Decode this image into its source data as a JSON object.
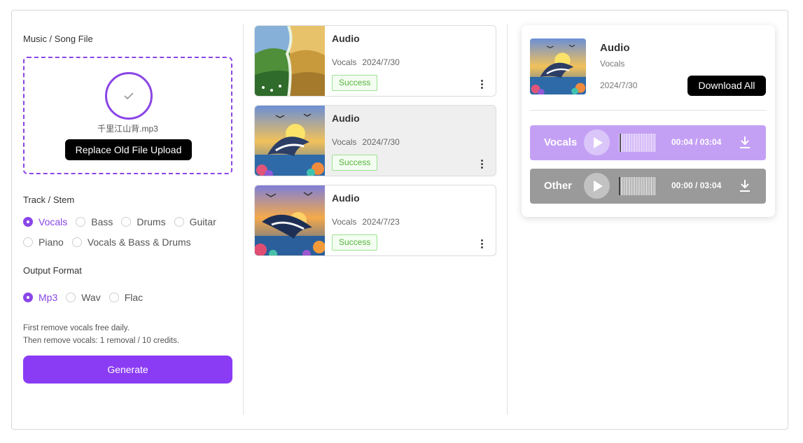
{
  "upload": {
    "section_title": "Music / Song File",
    "file_name": "千里江山背.mp3",
    "replace_label": "Replace Old File Upload"
  },
  "stems": {
    "section_title": "Track / Stem",
    "options": [
      "Vocals",
      "Bass",
      "Drums",
      "Guitar",
      "Piano",
      "Vocals & Bass & Drums"
    ],
    "selected": "Vocals"
  },
  "format": {
    "section_title": "Output Format",
    "options": [
      "Mp3",
      "Wav",
      "Flac"
    ],
    "selected": "Mp3"
  },
  "notes": {
    "line1": "First remove vocals free daily.",
    "line2": "Then remove vocals: 1 removal / 10 credits."
  },
  "generate_label": "Generate",
  "history": [
    {
      "title": "Audio",
      "type": "Vocals",
      "date": "2024/7/30",
      "status": "Success"
    },
    {
      "title": "Audio",
      "type": "Vocals",
      "date": "2024/7/30",
      "status": "Success"
    },
    {
      "title": "Audio",
      "type": "Vocals",
      "date": "2024/7/23",
      "status": "Success"
    }
  ],
  "detail": {
    "title": "Audio",
    "type": "Vocals",
    "date": "2024/7/30",
    "download_all_label": "Download All",
    "tracks": [
      {
        "name": "Vocals",
        "time": "00:04 / 03:04",
        "progress": 0.02,
        "color": "#c4a0f5"
      },
      {
        "name": "Other",
        "time": "00:00 / 03:04",
        "progress": 0.0,
        "color": "#9a9a9a"
      }
    ]
  },
  "colors": {
    "accent": "#8a3cf5",
    "success": "#52b33a"
  }
}
